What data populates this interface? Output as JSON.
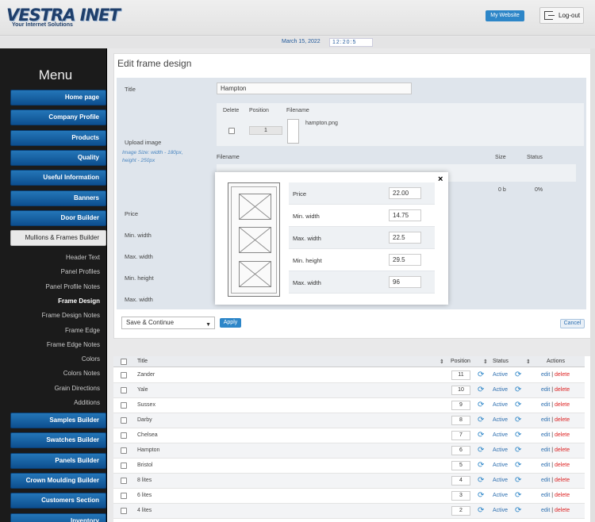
{
  "header": {
    "logo_text": "VESTRA INET",
    "tagline": "Your Internet Solutions",
    "my_website": "My Website",
    "logout": "Log-out",
    "date": "March 15, 2022",
    "time": "12:20:5"
  },
  "sidebar": {
    "title": "Menu",
    "buttons_top": [
      "Home page",
      "Company Profile",
      "Products",
      "Quality",
      "Useful Information",
      "Banners",
      "Door Builder"
    ],
    "active_section": "Mullions & Frames Builder",
    "sub_items": [
      "Header Text",
      "Panel Profiles",
      "Panel Profile Notes",
      "Frame Design",
      "Frame Design Notes",
      "Frame Edge",
      "Frame Edge Notes",
      "Colors",
      "Colors Notes",
      "Grain Directions",
      "Additions"
    ],
    "current_sub": "Frame Design",
    "buttons_bottom": [
      "Samples Builder",
      "Swatches Builder",
      "Panels Builder",
      "Crown Moulding Builder",
      "Customers Section",
      "Inventory"
    ]
  },
  "main": {
    "page_title": "Edit frame design",
    "labels": {
      "title": "Title",
      "upload": "Upload image",
      "price": "Price",
      "min_width": "Min. width",
      "max_width": "Max. width",
      "min_height": "Min. height",
      "max_width2": "Max. width"
    },
    "title_value": "Hampton",
    "hint_line1": "Image Size: width - 180px,",
    "hint_line2": "height - 250px",
    "upload_table": {
      "headers": [
        "Delete",
        "Position",
        "Filename"
      ],
      "position": "1",
      "filename": "hampton.png"
    },
    "queue": {
      "headers": [
        "Filename",
        "Size",
        "Status"
      ],
      "size": "0 b",
      "status": "0%"
    },
    "save_select": "Save & Continue",
    "apply": "Apply",
    "cancel": "Cancel"
  },
  "table": {
    "headers": [
      "Title",
      "Position",
      "Status",
      "Actions"
    ],
    "edit_label": "edit",
    "delete_label": "delete",
    "separator": "|",
    "rows": [
      {
        "title": "Zander",
        "position": "11",
        "status": "Active"
      },
      {
        "title": "Yale",
        "position": "10",
        "status": "Active"
      },
      {
        "title": "Sussex",
        "position": "9",
        "status": "Active"
      },
      {
        "title": "Darby",
        "position": "8",
        "status": "Active"
      },
      {
        "title": "Chelsea",
        "position": "7",
        "status": "Active"
      },
      {
        "title": "Hampton",
        "position": "6",
        "status": "Active"
      },
      {
        "title": "Bristol",
        "position": "5",
        "status": "Active"
      },
      {
        "title": "8 lites",
        "position": "4",
        "status": "Active"
      },
      {
        "title": "6 lites",
        "position": "3",
        "status": "Active"
      },
      {
        "title": "4 lites",
        "position": "2",
        "status": "Active"
      }
    ]
  },
  "modal": {
    "close": "×",
    "rows": [
      {
        "label": "Price",
        "value": "22.00"
      },
      {
        "label": "Min. width",
        "value": "14.75"
      },
      {
        "label": "Max. width",
        "value": "22.5"
      },
      {
        "label": "Min. height",
        "value": "29.5"
      },
      {
        "label": "Max. width",
        "value": "96"
      }
    ]
  }
}
